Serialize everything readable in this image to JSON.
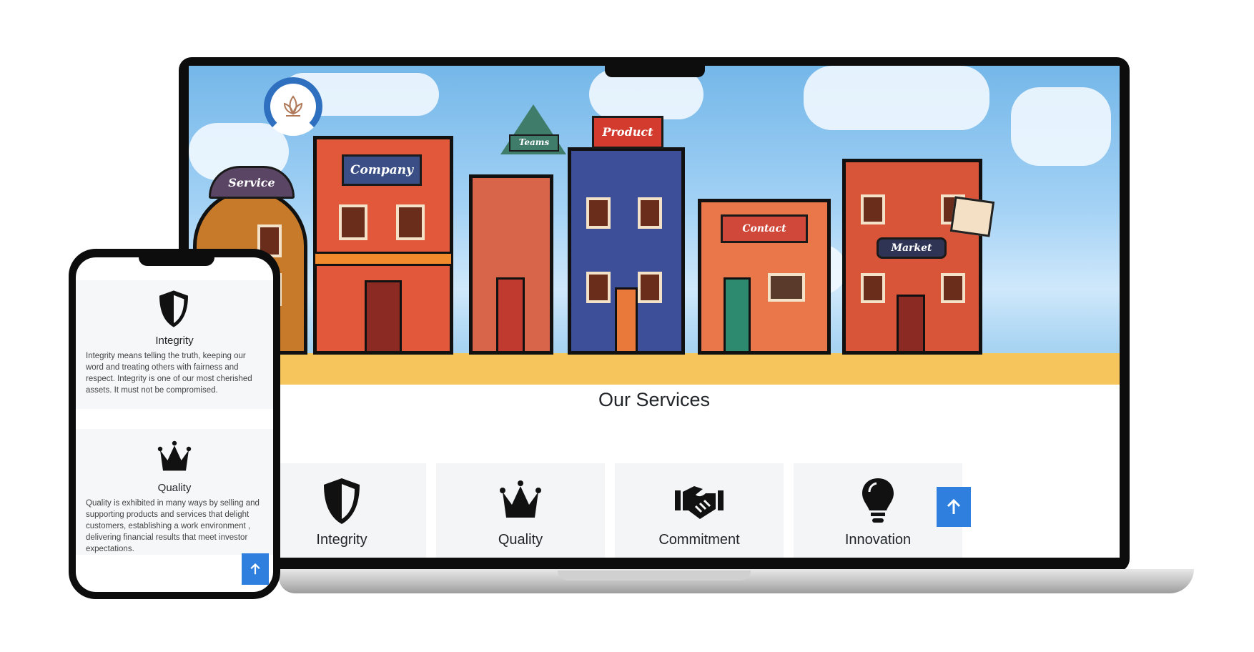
{
  "hero": {
    "signs": {
      "service": "Service",
      "company": "Company",
      "teams": "Teams",
      "product": "Product",
      "contact": "Contact",
      "market": "Market"
    },
    "colors": {
      "sky": "#74b7e9",
      "ground": "#f6c55b",
      "brand_blue": "#2f6fbf"
    }
  },
  "services": {
    "title": "Our Services",
    "cards": [
      {
        "label": "Integrity",
        "icon": "shield-icon"
      },
      {
        "label": "Quality",
        "icon": "crown-icon"
      },
      {
        "label": "Commitment",
        "icon": "handshake-icon"
      },
      {
        "label": "Innovation",
        "icon": "lightbulb-icon"
      }
    ]
  },
  "mobile": {
    "cards": [
      {
        "title": "Integrity",
        "icon": "shield-icon",
        "description": "Integrity means telling the truth, keeping our word and treating others with fairness and respect. Integrity is one of our most cherished assets. It must not be compromised."
      },
      {
        "title": "Quality",
        "icon": "crown-icon",
        "description": "Quality is exhibited in many ways by selling and supporting products and services that delight customers, establishing a work environment , delivering financial results that meet investor expectations."
      }
    ]
  },
  "scroll_top": {
    "icon": "arrow-up-icon",
    "color": "#2f7fdf"
  }
}
